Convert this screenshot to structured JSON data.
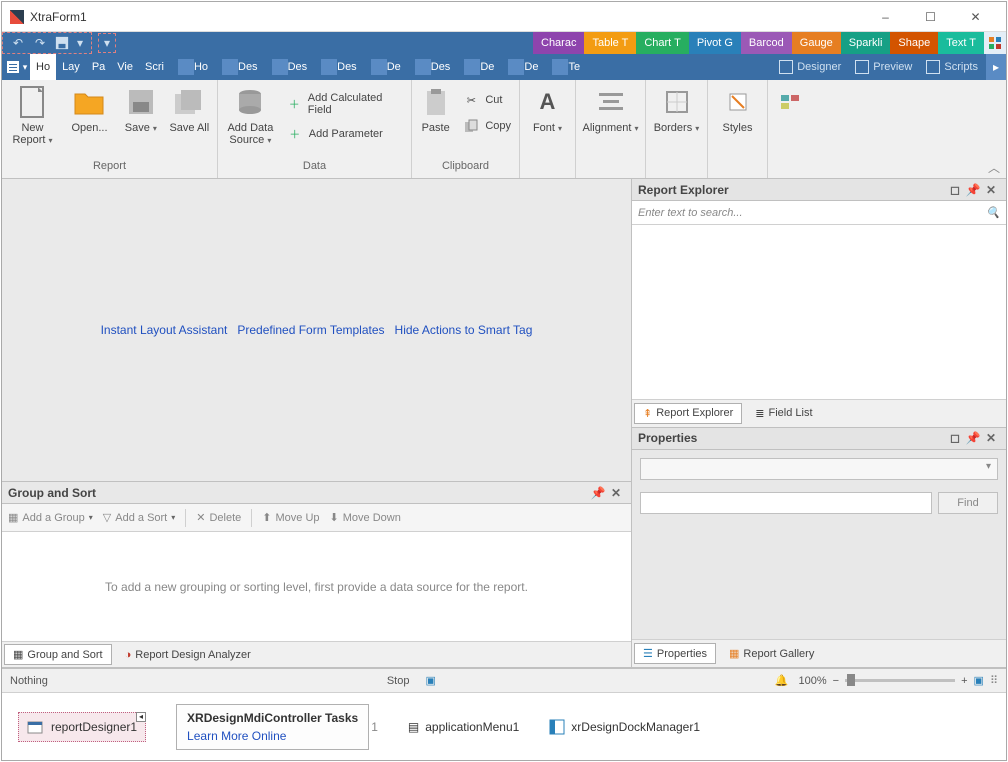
{
  "window": {
    "title": "XtraForm1"
  },
  "tool_tabs": [
    {
      "label": "Charac",
      "color": "#8e44ad"
    },
    {
      "label": "Table T",
      "color": "#f39c12"
    },
    {
      "label": "Chart T",
      "color": "#27ae60"
    },
    {
      "label": "Pivot G",
      "color": "#2980b9"
    },
    {
      "label": "Barcod",
      "color": "#9b59b6"
    },
    {
      "label": "Gauge",
      "color": "#e67e22"
    },
    {
      "label": "Sparkli",
      "color": "#16a085"
    },
    {
      "label": "Shape",
      "color": "#d35400"
    },
    {
      "label": "Text T",
      "color": "#1abc9c"
    }
  ],
  "page_tabs": [
    "Ho",
    "Lay",
    "Pa",
    "Vie",
    "Scri",
    "Ho",
    "Des",
    "Des",
    "Des",
    "De",
    "Des",
    "De",
    "De",
    "Te"
  ],
  "active_page_tab": 0,
  "mode_buttons": {
    "designer": "Designer",
    "preview": "Preview",
    "scripts": "Scripts"
  },
  "ribbon": {
    "report": {
      "label": "Report",
      "new_report": "New Report",
      "open": "Open...",
      "save": "Save",
      "save_all": "Save All"
    },
    "data": {
      "label": "Data",
      "add_ds": "Add Data\nSource",
      "add_calc": "Add Calculated Field",
      "add_param": "Add Parameter"
    },
    "clipboard": {
      "label": "Clipboard",
      "paste": "Paste",
      "cut": "Cut",
      "copy": "Copy"
    },
    "font": {
      "label": "Font"
    },
    "alignment": {
      "label": "Alignment"
    },
    "borders": {
      "label": "Borders"
    },
    "styles": {
      "label": "Styles"
    }
  },
  "canvas_links": {
    "layout_assist": "Instant Layout Assistant",
    "templates": "Predefined Form Templates",
    "hide_smart": "Hide Actions to Smart Tag"
  },
  "group_sort": {
    "title": "Group and Sort",
    "add_group": "Add a Group",
    "add_sort": "Add a Sort",
    "delete": "Delete",
    "move_up": "Move Up",
    "move_down": "Move Down",
    "empty_msg": "To add a new grouping or sorting level, first provide a data source for the report."
  },
  "left_bottom_tabs": {
    "group_sort": "Group and Sort",
    "analyzer": "Report Design Analyzer"
  },
  "explorer": {
    "title": "Report Explorer",
    "search_placeholder": "Enter text to search...",
    "tab_explorer": "Report Explorer",
    "tab_fields": "Field List"
  },
  "properties": {
    "title": "Properties",
    "find": "Find",
    "tab_props": "Properties",
    "tab_gallery": "Report Gallery"
  },
  "status": {
    "left": "Nothing",
    "stop": "Stop",
    "zoom": "100%"
  },
  "tray": {
    "selected": "reportDesigner1",
    "tasks_title": "XRDesignMdiController Tasks",
    "learn_more": "Learn More Online",
    "app_menu": "applicationMenu1",
    "dock_mgr": "xrDesignDockManager1"
  }
}
